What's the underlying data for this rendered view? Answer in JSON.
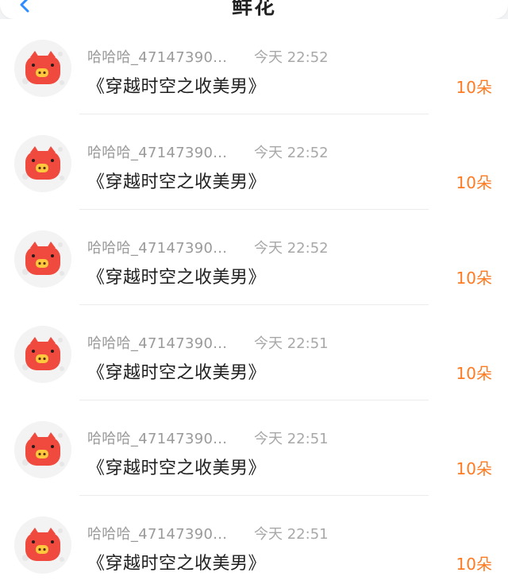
{
  "header": {
    "title": "鲜花"
  },
  "colors": {
    "accent_orange": "#ff7a21",
    "avatar_red": "#f04a3f",
    "avatar_face": "#ffc83d"
  },
  "list": {
    "items": [
      {
        "name": "哈哈哈_47147390...",
        "time": "今天 22:52",
        "title": "《穿越时空之收美男》",
        "count": "10朵"
      },
      {
        "name": "哈哈哈_47147390...",
        "time": "今天 22:52",
        "title": "《穿越时空之收美男》",
        "count": "10朵"
      },
      {
        "name": "哈哈哈_47147390...",
        "time": "今天 22:52",
        "title": "《穿越时空之收美男》",
        "count": "10朵"
      },
      {
        "name": "哈哈哈_47147390...",
        "time": "今天 22:51",
        "title": "《穿越时空之收美男》",
        "count": "10朵"
      },
      {
        "name": "哈哈哈_47147390...",
        "time": "今天 22:51",
        "title": "《穿越时空之收美男》",
        "count": "10朵"
      },
      {
        "name": "哈哈哈_47147390...",
        "time": "今天 22:51",
        "title": "《穿越时空之收美男》",
        "count": "10朵"
      }
    ]
  }
}
